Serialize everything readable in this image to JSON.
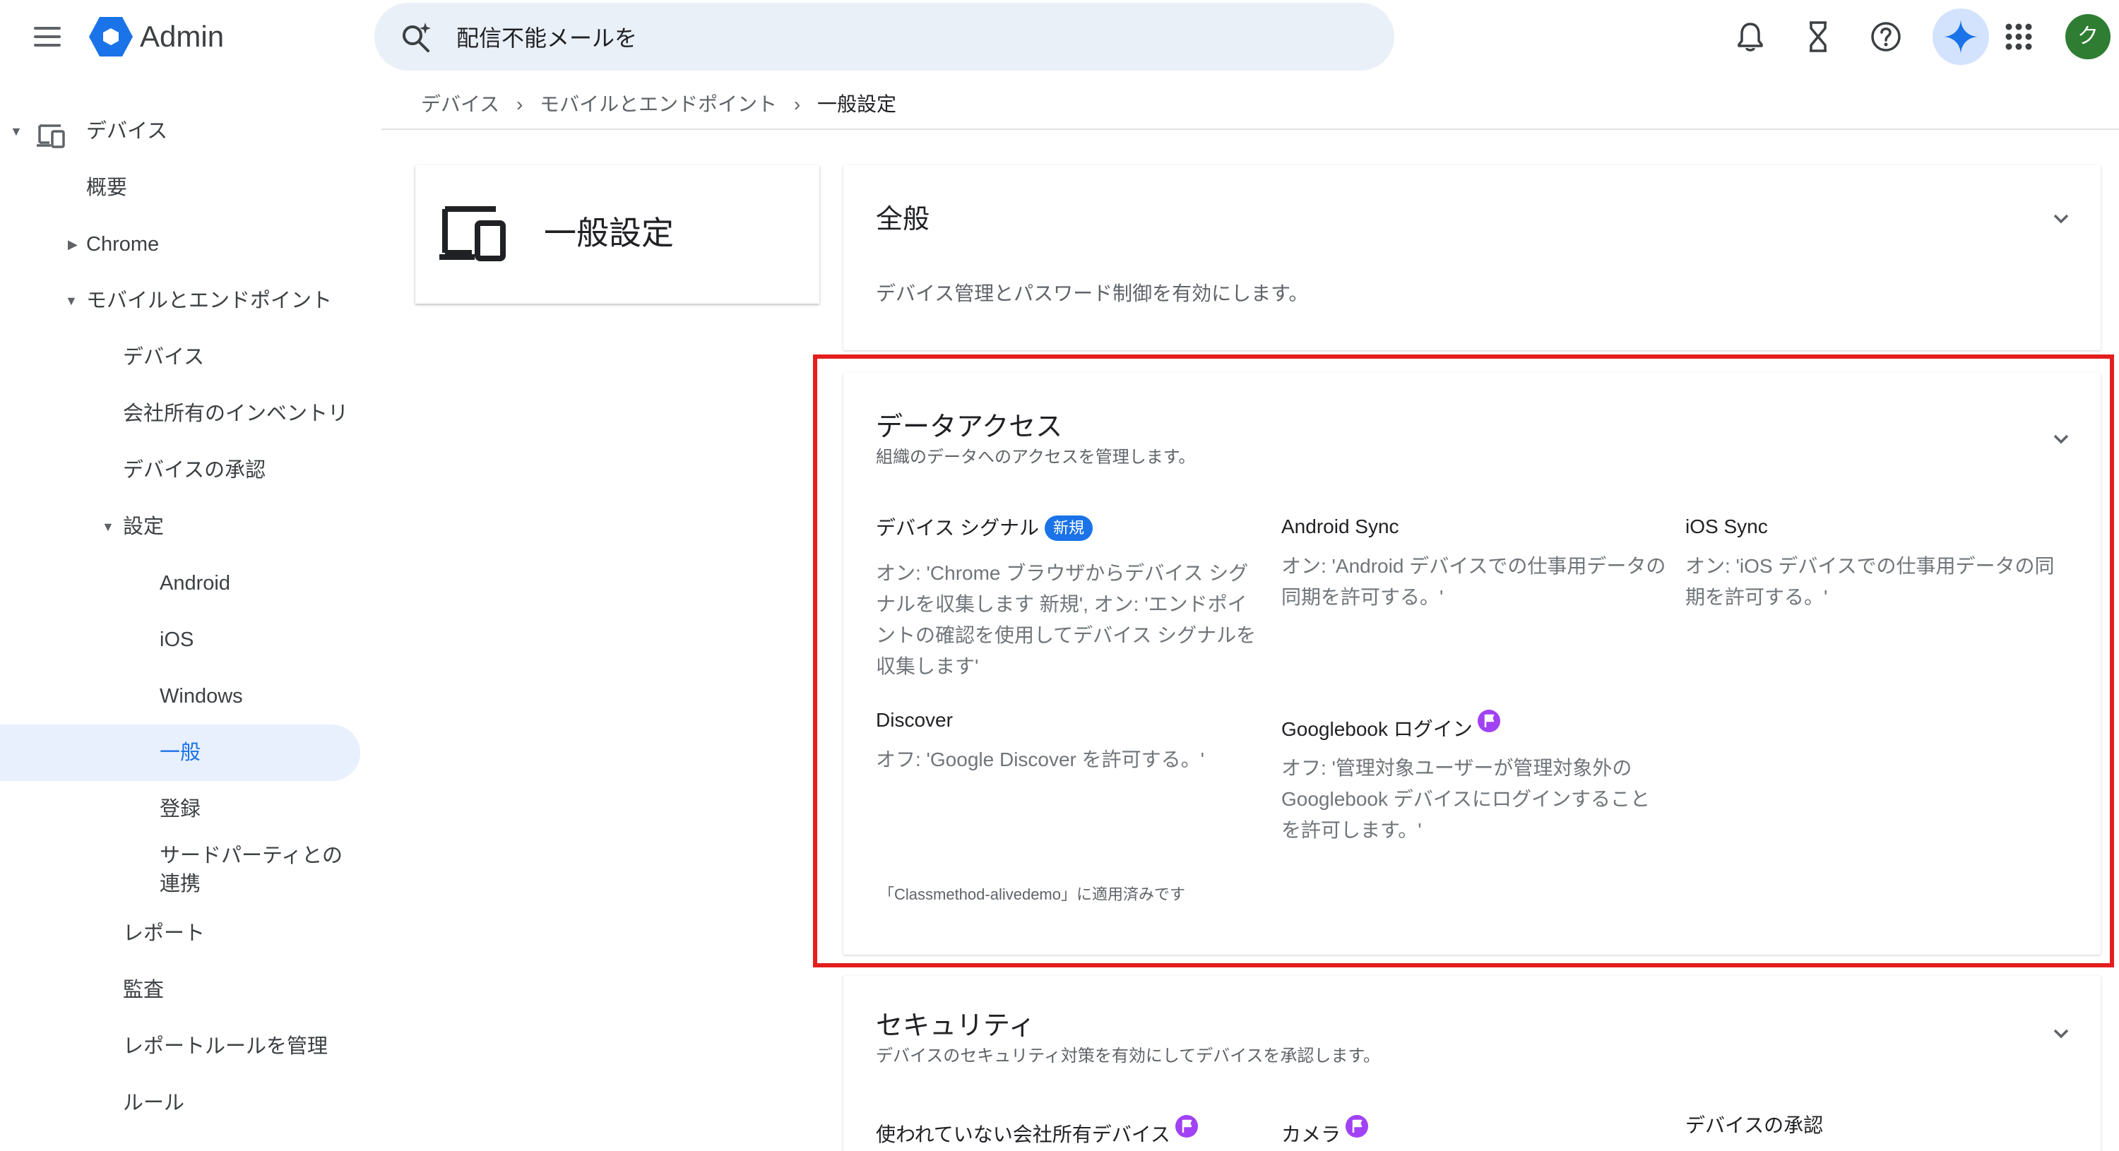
{
  "header": {
    "app_title": "Admin",
    "search_value": "配信不能メールを",
    "avatar_initial": "ク",
    "icons": [
      "menu-icon",
      "admin-logo",
      "search-sparkle-icon",
      "bell-icon",
      "hourglass-icon",
      "help-icon",
      "gemini-icon",
      "apps-grid-icon"
    ]
  },
  "sidebar": {
    "devices": "デバイス",
    "overview": "概要",
    "chrome": "Chrome",
    "mobile_endpoints": "モバイルとエンドポイント",
    "mobile_devices": "デバイス",
    "company_inventory": "会社所有のインベントリ",
    "device_approval": "デバイスの承認",
    "settings": "設定",
    "android": "Android",
    "ios": "iOS",
    "windows": "Windows",
    "general": "一般",
    "enrollment": "登録",
    "third_party_line1": "サードパーティとの",
    "third_party_line2": "連携",
    "reports": "レポート",
    "audit": "監査",
    "manage_report_rules": "レポートルールを管理",
    "rules": "ルール"
  },
  "breadcrumb": {
    "item1": "デバイス",
    "item2": "モバイルとエンドポイント",
    "current": "一般設定",
    "separator": "›"
  },
  "title_card": {
    "label": "一般設定"
  },
  "sections": {
    "general": {
      "title": "全般",
      "description": "デバイス管理とパスワード制御を有効にします。"
    },
    "data_access": {
      "title": "データアクセス",
      "description": "組織のデータへのアクセスを管理します。",
      "device_signals": {
        "title": "デバイス シグナル",
        "badge": "新規",
        "value": "オン: 'Chrome ブラウザからデバイス シグナルを収集します 新規', オン: 'エンドポイントの確認を使用してデバイス シグナルを収集します'"
      },
      "android_sync": {
        "title": "Android Sync",
        "value": "オン: 'Android デバイスでの仕事用データの同期を許可する。'"
      },
      "ios_sync": {
        "title": "iOS Sync",
        "value": "オン: 'iOS デバイスでの仕事用データの同期を許可する。'"
      },
      "discover": {
        "title": "Discover",
        "value": "オフ: 'Google Discover を許可する。'"
      },
      "googlebook_login": {
        "title": "Googlebook ログイン",
        "value": "オフ: '管理対象ユーザーが管理対象外の Googlebook デバイスにログインすることを許可します。'"
      },
      "applied_to": "「Classmethod-alivedemo」に適用済みです"
    },
    "security": {
      "title": "セキュリティ",
      "description": "デバイスのセキュリティ対策を有効にしてデバイスを承認します。",
      "unused_devices": "使われていない会社所有デバイス",
      "camera": "カメラ",
      "device_approval": "デバイスの承認"
    }
  },
  "colors": {
    "accent": "#1a73e8",
    "active_nav_bg": "#e8f0fe",
    "highlight_border": "#e41e1e",
    "flag": "#a142f4",
    "avatar": "#2e7d32"
  }
}
